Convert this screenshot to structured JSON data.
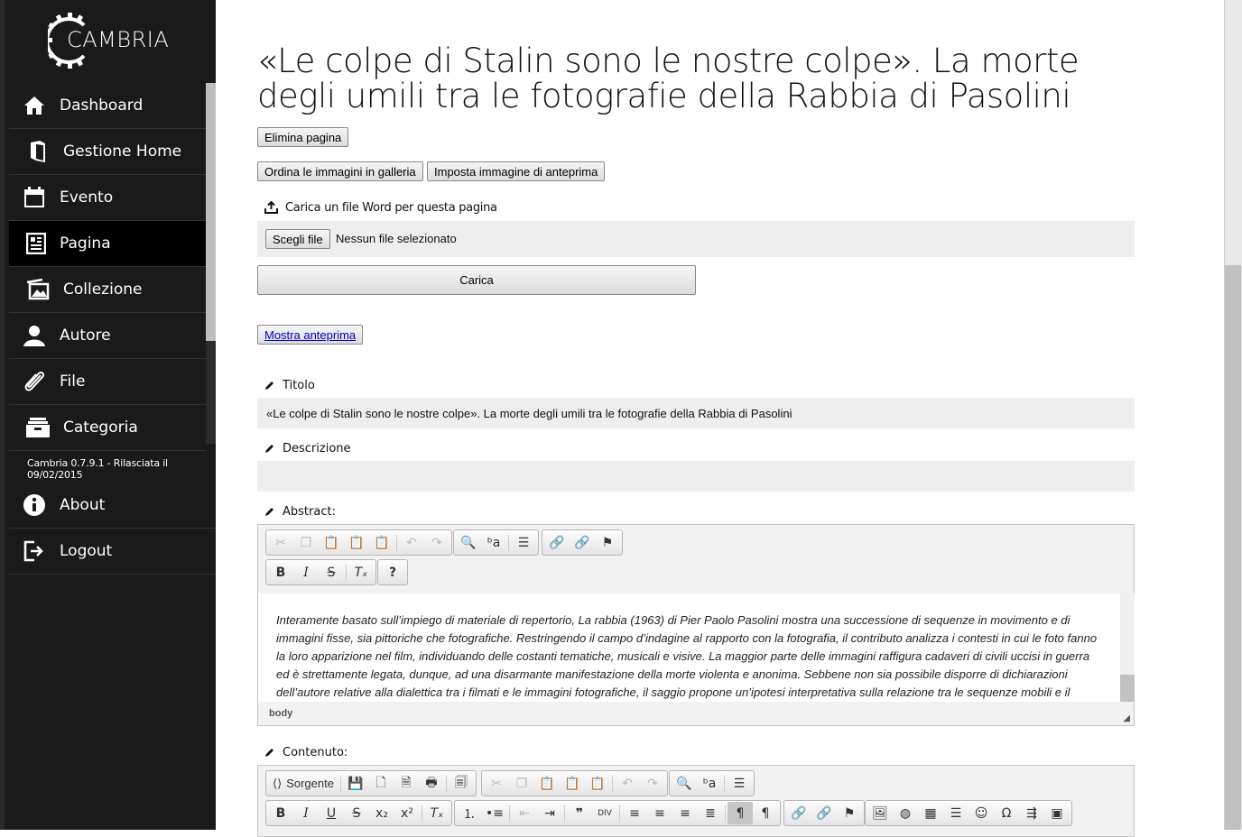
{
  "brand": {
    "name": "CAMBRIA"
  },
  "nav": [
    {
      "label": "Dashboard",
      "icon": "home-icon"
    },
    {
      "label": "Gestione Home",
      "icon": "book-icon"
    },
    {
      "label": "Evento",
      "icon": "calendar-icon"
    },
    {
      "label": "Pagina",
      "icon": "newspaper-icon",
      "active": true
    },
    {
      "label": "Collezione",
      "icon": "gallery-icon"
    },
    {
      "label": "Autore",
      "icon": "user-icon"
    },
    {
      "label": "File",
      "icon": "paperclip-icon"
    },
    {
      "label": "Categoria",
      "icon": "box-icon"
    }
  ],
  "version": "Cambria 0.7.9.1 - Rilasciata il 09/02/2015",
  "nav2": [
    {
      "label": "About",
      "icon": "info-icon"
    },
    {
      "label": "Logout",
      "icon": "logout-icon"
    }
  ],
  "page": {
    "title": "«Le colpe di Stalin sono le nostre colpe». La morte degli umili tra le fotografie della Rabbia di Pasolini",
    "delete_btn": "Elimina pagina",
    "order_btn": "Ordina le immagini in galleria",
    "preview_img_btn": "Imposta immagine di anteprima",
    "upload_label": "Carica un file Word per questa pagina",
    "choose_file": "Scegli file",
    "no_file": "Nessun file selezionato",
    "upload_btn": "Carica",
    "show_preview": "Mostra anteprima",
    "title_label": "Titolo",
    "title_value": "«Le colpe di Stalin sono le nostre colpe». La morte degli umili tra le fotografie della Rabbia di Pasolini",
    "desc_label": "Descrizione",
    "desc_value": "",
    "abstract_label": "Abstract:",
    "abstract_text": "Interamente basato sull’impiego di materiale di repertorio, La rabbia (1963) di Pier Paolo Pasolini mostra una successione di sequenze in movimento e di immagini fisse, sia pittoriche che fotografiche. Restringendo il campo d’indagine al rapporto con la fotografia, il contributo analizza i contesti in cui le foto fanno la loro apparizione nel film, individuando delle costanti tematiche, musicali e visive. La maggior parte delle immagini raffigura cadaveri di civili uccisi in guerra ed è strettamente legata, dunque, ad una disarmante manifestazione della morte violenta e anonima. Sebbene non sia possibile disporre di dichiarazioni dell’autore relative alla dialettica tra i filmati e le immagini fotografiche, il saggio propone un’ipotesi interpretativa sulla relazione tra le sequenze mobili e il",
    "abstract_path": "body",
    "content_label": "Contenuto:",
    "source_btn": "Sorgente"
  }
}
